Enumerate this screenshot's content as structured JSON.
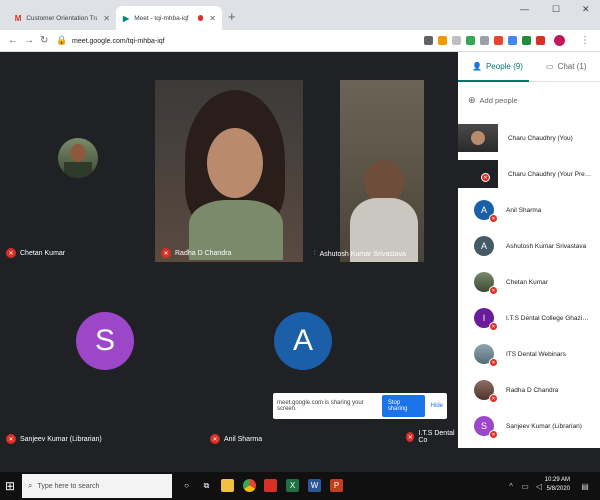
{
  "browser": {
    "tabs": [
      {
        "title": "Customer Orientation Training S",
        "icon": "gmail-icon"
      },
      {
        "title": "Meet - tqi-mhba-iqf",
        "icon": "meet-icon",
        "recording": true
      }
    ],
    "url": "meet.google.com/tqi-mhba-iqf"
  },
  "meet": {
    "tiles": [
      {
        "name": "Chetan Kumar"
      },
      {
        "name": "Radha D Chandra"
      },
      {
        "name": "Ashutosh Kumar Srivastava"
      },
      {
        "name": "Sanjeev Kumar (Librarian)",
        "initial": "S",
        "color": "#9c46c9"
      },
      {
        "name": "Anil Sharma",
        "initial": "A",
        "color": "#1a5fa8"
      },
      {
        "name": "I.T.S Dental Co"
      }
    ],
    "share_bar": {
      "text": "meet.google.com is sharing your screen.",
      "stop": "Stop sharing",
      "hide": "Hide"
    }
  },
  "panel": {
    "people_tab": "People (9)",
    "chat_tab": "Chat (1)",
    "add_people": "Add people",
    "people": [
      {
        "name": "Charu Chaudhry (You)",
        "type": "video"
      },
      {
        "name": "Charu Chaudhry (Your Present...",
        "type": "present"
      },
      {
        "name": "Anil Sharma",
        "initial": "A",
        "color": "#1a5fa8"
      },
      {
        "name": "Ashutosh Kumar Srivastava",
        "initial": "A",
        "color": "#455a64"
      },
      {
        "name": "Chetan Kumar",
        "type": "photo"
      },
      {
        "name": "I.T.S Dental College Ghaziabad",
        "initial": "I",
        "color": "#6a1b9a"
      },
      {
        "name": "ITS Dental Webinars",
        "type": "photo"
      },
      {
        "name": "Radha D Chandra",
        "type": "photo"
      },
      {
        "name": "Sanjeev Kumar (Librarian)",
        "initial": "S",
        "color": "#9c46c9"
      }
    ]
  },
  "taskbar": {
    "search_placeholder": "Type here to search",
    "time": "10:29 AM",
    "date": "5/8/2020"
  },
  "colors": {
    "accent": "#00796b",
    "mute": "#d93025",
    "stop": "#1a73e8"
  }
}
